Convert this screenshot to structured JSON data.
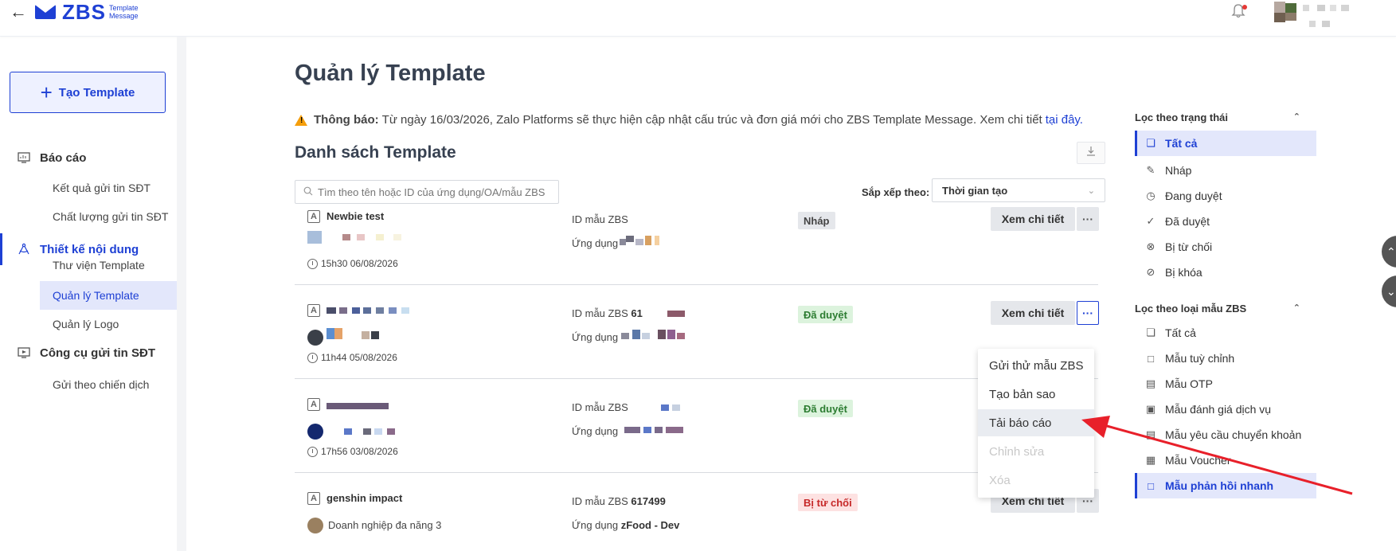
{
  "header": {
    "logo_text": "ZBS",
    "logo_sub": "Template Message"
  },
  "sidebar": {
    "create_label": "Tạo Template",
    "sections": [
      {
        "label": "Báo cáo",
        "items": [
          "Kết quả gửi tin SĐT",
          "Chất lượng gửi tin SĐT"
        ]
      },
      {
        "label": "Thiết kế nội dung",
        "items": [
          "Thư viện Template",
          "Quản lý Template",
          "Quản lý Logo"
        ]
      },
      {
        "label": "Công cụ gửi tin SĐT",
        "items": [
          "Gửi theo chiến dịch"
        ]
      }
    ]
  },
  "main": {
    "page_title": "Quản lý Template",
    "notice_label": "Thông báo:",
    "notice_text": "Từ ngày 16/03/2026, Zalo Platforms sẽ thực hiện cập nhật cấu trúc và đơn giá mới cho ZBS Template Message. Xem chi tiết",
    "notice_link": "tại đây.",
    "list_title": "Danh sách Template",
    "search_placeholder": "Tìm theo tên hoặc ID của ứng dụng/OA/mẫu ZBS",
    "sort_label": "Sắp xếp theo:",
    "sort_value": "Thời gian tạo",
    "id_label": "ID mẫu ZBS",
    "app_label": "Ứng dụng",
    "detail_label": "Xem chi tiết",
    "more_label": "···",
    "rows": [
      {
        "name": "Newbie test",
        "id": "",
        "app": "",
        "owner": "",
        "time": "15h30 06/08/2026",
        "status": "Nháp"
      },
      {
        "name": "",
        "id": "61",
        "app": "",
        "owner": "",
        "time": "11h44 05/08/2026",
        "status": "Đã duyệt"
      },
      {
        "name": "",
        "id": "",
        "app": "",
        "owner": "",
        "time": "17h56 03/08/2026",
        "status": "Đã duyệt"
      },
      {
        "name": "genshin impact",
        "id": "617499",
        "app": "zFood - Dev",
        "owner": "Doanh nghiệp đa năng 3",
        "time": "",
        "status": "Bị từ chối"
      }
    ]
  },
  "menu": {
    "items": [
      "Gửi thử mẫu ZBS",
      "Tạo bản sao",
      "Tải báo cáo",
      "Chỉnh sửa",
      "Xóa"
    ]
  },
  "filters": {
    "status_title": "Lọc theo trạng thái",
    "status_items": [
      "Tất cả",
      "Nháp",
      "Đang duyệt",
      "Đã duyệt",
      "Bị từ chối",
      "Bị khóa"
    ],
    "type_title": "Lọc theo loại mẫu ZBS",
    "type_items": [
      "Tất cả",
      "Mẫu tuỳ chỉnh",
      "Mẫu OTP",
      "Mẫu đánh giá dịch vụ",
      "Mẫu yêu cầu chuyển khoản",
      "Mẫu Voucher",
      "Mẫu phản hồi nhanh"
    ]
  }
}
